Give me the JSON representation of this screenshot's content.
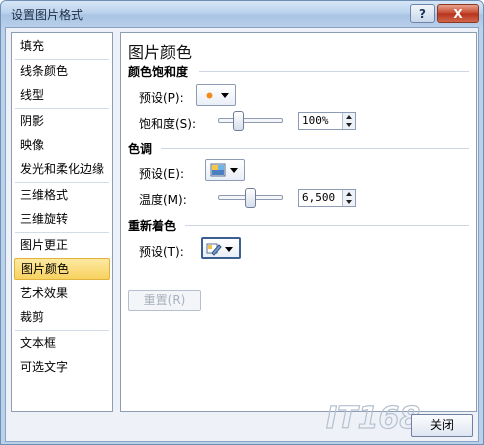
{
  "window": {
    "title": "设置图片格式",
    "help_label": "?",
    "close_glyph": "X"
  },
  "nav": {
    "items": [
      {
        "label": "填充"
      },
      {
        "label": "线条颜色"
      },
      {
        "label": "线型"
      },
      {
        "label": "阴影"
      },
      {
        "label": "映像"
      },
      {
        "label": "发光和柔化边缘"
      },
      {
        "label": "三维格式"
      },
      {
        "label": "三维旋转"
      },
      {
        "label": "图片更正"
      },
      {
        "label": "图片颜色",
        "selected": true
      },
      {
        "label": "艺术效果"
      },
      {
        "label": "裁剪"
      },
      {
        "label": "文本框"
      },
      {
        "label": "可选文字"
      }
    ]
  },
  "panel": {
    "title": "图片颜色",
    "saturation": {
      "heading": "颜色饱和度",
      "preset_label": "预设(P):",
      "amount_label": "饱和度(S):",
      "amount_value": "100%",
      "slider_fraction": 0.28
    },
    "tone": {
      "heading": "色调",
      "preset_label": "预设(E):",
      "temperature_label": "温度(M):",
      "temperature_value": "6,500",
      "slider_fraction": 0.5
    },
    "recolor": {
      "heading": "重新着色",
      "preset_label": "预设(T):",
      "reset_label": "重置(R)"
    }
  },
  "footer": {
    "close_label": "关闭",
    "watermark": "IT168"
  },
  "colors": {
    "selected_item": "#f8d25f",
    "dot_orange": "#f28b1c"
  }
}
